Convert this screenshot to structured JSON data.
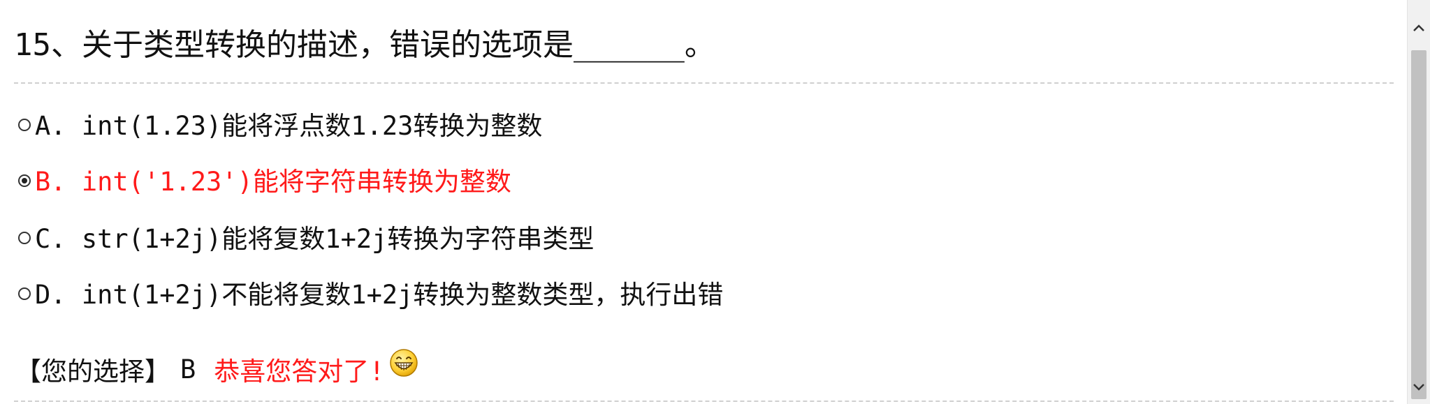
{
  "question": {
    "title": "15、关于类型转换的描述，错误的选项是______。"
  },
  "options": [
    {
      "text": "A. int(1.23)能将浮点数1.23转换为整数",
      "selected": false
    },
    {
      "text": "B. int('1.23')能将字符串转换为整数",
      "selected": true
    },
    {
      "text": "C. str(1+2j)能将复数1+2j转换为字符串类型",
      "selected": false
    },
    {
      "text": "D. int(1+2j)不能将复数1+2j转换为整数类型，执行出错",
      "selected": false
    }
  ],
  "result": {
    "label": "【您的选择】",
    "answer": "B",
    "feedback": "恭喜您答对了!"
  },
  "colors": {
    "selected_option": "#ff1a1a",
    "feedback": "#ff1a1a",
    "text": "#111111",
    "divider": "#cfcfcf"
  },
  "icons": {
    "result_emoji": "grinning-face-icon",
    "scroll_up": "chevron-up-icon",
    "scroll_down": "chevron-down-icon"
  }
}
